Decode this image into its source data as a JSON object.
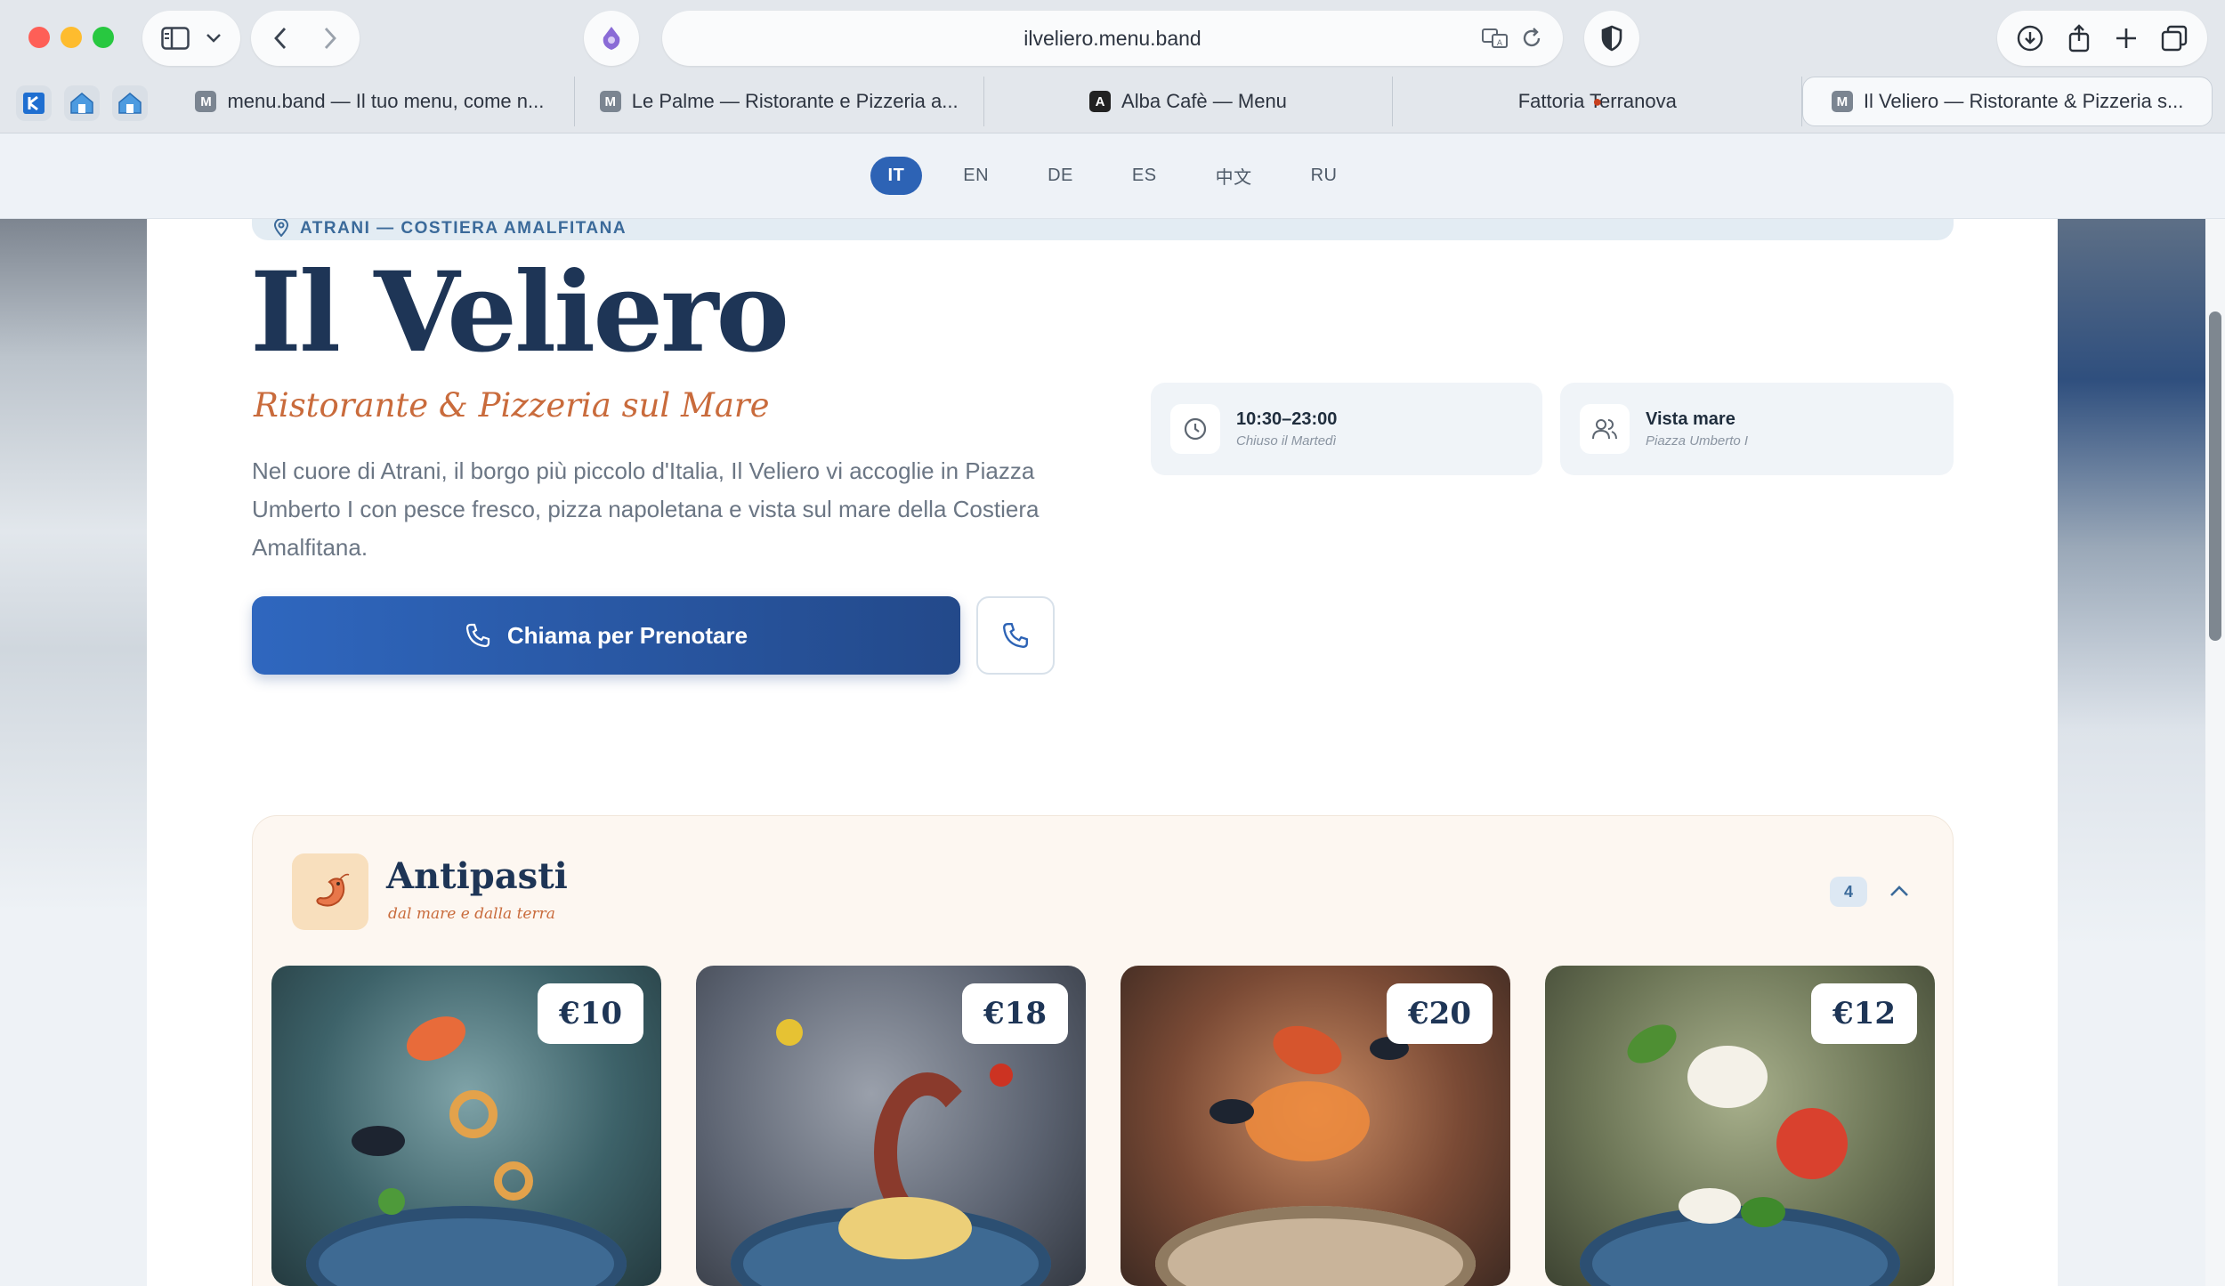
{
  "browser": {
    "url": "ilveliero.menu.band",
    "tabs": [
      {
        "favicon": "M",
        "label": "menu.band — Il tuo menu, come n..."
      },
      {
        "favicon": "M",
        "label": "Le Palme — Ristorante e Pizzeria a..."
      },
      {
        "favicon": "A",
        "label": "Alba Cafè — Menu"
      },
      {
        "favicon": "food-icon",
        "label": "Fattoria Terranova"
      },
      {
        "favicon": "M",
        "label": "Il Veliero — Ristorante & Pizzeria s..."
      }
    ],
    "active_tab": 4
  },
  "languages": {
    "items": [
      "IT",
      "EN",
      "DE",
      "ES",
      "中文",
      "RU"
    ],
    "active": "IT"
  },
  "hero": {
    "location": "ATRANI — COSTIERA AMALFITANA",
    "title": "Il Veliero",
    "subtitle": "Ristorante & Pizzeria sul Mare",
    "intro": "Nel cuore di Atrani, il borgo più piccolo d'Italia, Il Veliero vi accoglie in Piazza Umberto I con pesce fresco, pizza napoletana e vista sul mare della Costiera Amalfitana.",
    "cta_label": "Chiama per Prenotare"
  },
  "info": {
    "hours": {
      "main": "10:30–23:00",
      "sub": "Chiuso il Martedì"
    },
    "view": {
      "main": "Vista mare",
      "sub": "Piazza Umberto I"
    }
  },
  "section": {
    "title": "Antipasti",
    "subtitle": "dal mare e dalla terra",
    "count": "4",
    "items": [
      {
        "price": "€10"
      },
      {
        "price": "€18"
      },
      {
        "price": "€20"
      },
      {
        "price": "€12"
      }
    ]
  },
  "colors": {
    "accent": "#2d63b5",
    "title": "#1e3556",
    "script_accent": "#c96b3c"
  }
}
